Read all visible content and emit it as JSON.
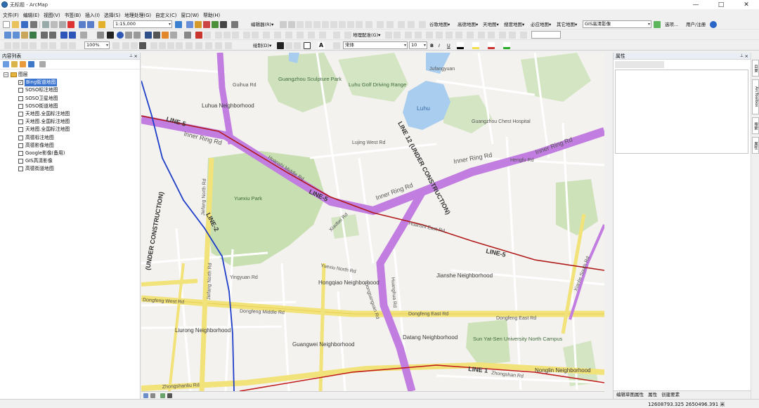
{
  "window": {
    "title": "无标题 - ArcMap",
    "controls": [
      "—",
      "□",
      "✕"
    ]
  },
  "menu": [
    "文件(F)",
    "编辑(E)",
    "视图(V)",
    "书签(B)",
    "插入(I)",
    "选择(S)",
    "地理处理(G)",
    "自定义(C)",
    "窗口(W)",
    "帮助(H)"
  ],
  "toolbar": {
    "scale": "1:15,000",
    "editor": "编辑器(R)▾",
    "basemaps": [
      "谷歌地图▾",
      "高德地图▾",
      "天地图▾",
      "搜度地图▾",
      "必应地图▾",
      "其它地图▾"
    ],
    "gis_select": "GIS高清影像",
    "options": "选项...",
    "user": "用户/注册",
    "georef": "地理配准(G)▾",
    "draw": "绘制(D)▾",
    "font": "宋体",
    "fontsize": "10",
    "bold": "B",
    "italic": "I",
    "underline": "U",
    "zoom": "100%"
  },
  "toc": {
    "title": "内容列表",
    "group": "图层",
    "layers": [
      {
        "label": "Bing街道地图",
        "checked": true,
        "selected": true
      },
      {
        "label": "SOSO标注地图",
        "checked": false
      },
      {
        "label": "SOSO卫星地图",
        "checked": false
      },
      {
        "label": "SOSO街道地图",
        "checked": false
      },
      {
        "label": "天地图.全国标注地图",
        "checked": false
      },
      {
        "label": "天地图.全国标注地图",
        "checked": false
      },
      {
        "label": "天地图.全国标注地图",
        "checked": false
      },
      {
        "label": "高德标注地图",
        "checked": false
      },
      {
        "label": "高德影像地图",
        "checked": false
      },
      {
        "label": "Google影像(备用)",
        "checked": false
      },
      {
        "label": "GIS高清影像",
        "checked": false
      },
      {
        "label": "高德街道地图",
        "checked": false
      }
    ]
  },
  "map": {
    "neighborhoods": [
      "Luhua Neighborhood",
      "Hongqiao Neighborhood",
      "Jianshe Neighborhood",
      "Liurong Neighborhood",
      "Guangwei Neighborhood",
      "Datang Neighborhood",
      "Nonglin Neighborhood"
    ],
    "parks": [
      "Guangzhou Sculpture Park",
      "Luhu Golf Driving Range",
      "Yuexiu Park",
      "Sun Yat-Sen University North Campus"
    ],
    "water": [
      "Luhu"
    ],
    "pois": [
      "Jufangyuan",
      "Guangzhou Chest Hospital"
    ],
    "roads": [
      "Inner Ring Rd",
      "Huanshi East Rd",
      "Huanshi Middle Rd",
      "Dongfeng Middle Rd",
      "Dongfeng East Rd",
      "Dongfeng West Rd",
      "Zhongshanliu Rd",
      "Jiefang North Rd",
      "Dongsanguan Rd",
      "Zhongshan Rd",
      "Xiaobei Rd",
      "Guihua Rd",
      "Lujing Rd",
      "Lujing West Rd",
      "Donghu Rd",
      "Hengfu Rd",
      "Yuexiu North Rd",
      "Huanghua Rd",
      "Yingyuan Rd",
      "Zhuang Rd",
      "Xuefeng Rd",
      "Xianlie South Rd"
    ],
    "metro": [
      "LINE-5",
      "LINE-2",
      "LINE 12 (UNDER CONSTRUCTION)",
      "LINE 1",
      "(UNDER CONSTRUCTION)"
    ]
  },
  "properties": {
    "title": "属性",
    "tabs": [
      "编辑草图属性",
      "属性",
      "创建要素"
    ]
  },
  "side_tabs": [
    "目录",
    "ArcToolbox",
    "搜索",
    "属性"
  ],
  "status": {
    "coords": "12608793.325  2650496.391 米"
  },
  "colors": {
    "metro_band": "#c17de0",
    "inner_ring": "#b77ce4",
    "dongfeng": "#f2e27a",
    "line2": "#1e3ec9",
    "line5": "#b01919",
    "water": "#a8cdef",
    "park": "#c8dfb2"
  }
}
